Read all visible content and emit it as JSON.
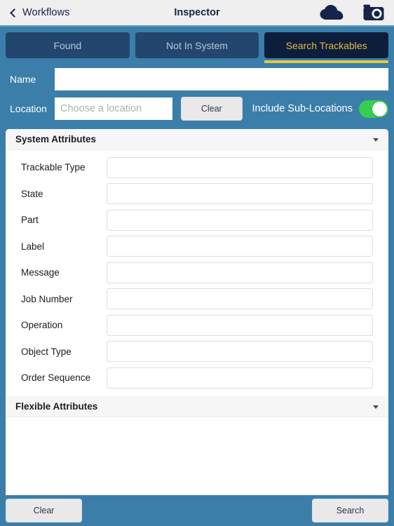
{
  "navbar": {
    "back_label": "Workflows",
    "back_icon": "chevron-left-icon",
    "title": "Inspector",
    "cloud_icon": "cloud-icon",
    "camera_icon": "camera-icon"
  },
  "tabs": [
    {
      "label": "Found",
      "active": false
    },
    {
      "label": "Not In System",
      "active": false
    },
    {
      "label": "Search Trackables",
      "active": true
    }
  ],
  "filters": {
    "name_label": "Name",
    "name_value": "",
    "name_placeholder": "",
    "location_label": "Location",
    "location_value": "",
    "location_placeholder": "Choose a location",
    "location_clear_label": "Clear",
    "include_sub_locations_label": "Include Sub-Locations",
    "include_sub_locations_on": true
  },
  "system_attributes": {
    "title": "System Attributes",
    "collapse_icon": "caret-down-icon",
    "fields": [
      {
        "label": "Trackable Type",
        "value": ""
      },
      {
        "label": "State",
        "value": ""
      },
      {
        "label": "Part",
        "value": ""
      },
      {
        "label": "Label",
        "value": ""
      },
      {
        "label": "Message",
        "value": ""
      },
      {
        "label": "Job Number",
        "value": ""
      },
      {
        "label": "Operation",
        "value": ""
      },
      {
        "label": "Object Type",
        "value": ""
      },
      {
        "label": "Order Sequence",
        "value": ""
      }
    ]
  },
  "flexible_attributes": {
    "title": "Flexible Attributes",
    "collapse_icon": "caret-down-icon",
    "fields": []
  },
  "footer": {
    "clear_label": "Clear",
    "search_label": "Search"
  },
  "colors": {
    "page_background": "#3b7ea9",
    "tab_inactive": "#22466e",
    "tab_active": "#0d1e3c",
    "tab_active_text": "#e5b93a",
    "tab_underline": "#e5c93c",
    "navbar_background": "#efeff0",
    "navbar_text": "#1b2340",
    "toggle_on": "#35ce50",
    "card_background": "#ffffff",
    "section_header_background": "#f6f6f6"
  }
}
